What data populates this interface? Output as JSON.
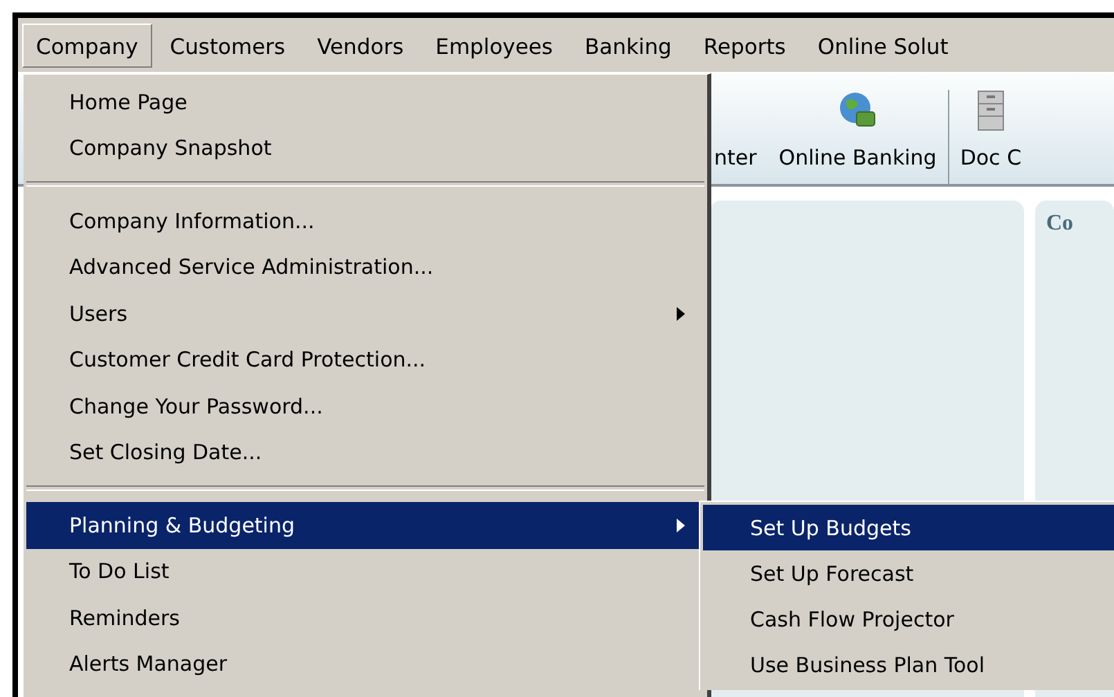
{
  "menu_bar": [
    {
      "label": "Company",
      "selected": true
    },
    {
      "label": "Customers",
      "selected": false
    },
    {
      "label": "Vendors",
      "selected": false
    },
    {
      "label": "Employees",
      "selected": false
    },
    {
      "label": "Banking",
      "selected": false
    },
    {
      "label": "Reports",
      "selected": false
    },
    {
      "label": "Online Solut",
      "selected": false
    }
  ],
  "toolbar": [
    {
      "label": "nter",
      "kind": "text"
    },
    {
      "label": "Online Banking",
      "kind": "globe"
    },
    {
      "label": "Doc C",
      "kind": "cabinet"
    }
  ],
  "panels": [
    {
      "kind": "blank"
    },
    {
      "kind": "titled",
      "title": "Co"
    }
  ],
  "dropdown": {
    "groups": [
      [
        {
          "label": "Home Page",
          "submenu": false,
          "selected": false
        },
        {
          "label": "Company Snapshot",
          "submenu": false,
          "selected": false
        }
      ],
      [
        {
          "label": "Company Information...",
          "submenu": false,
          "selected": false
        },
        {
          "label": "Advanced Service Administration...",
          "submenu": false,
          "selected": false
        },
        {
          "label": "Users",
          "submenu": true,
          "selected": false
        },
        {
          "label": "Customer Credit Card Protection...",
          "submenu": false,
          "selected": false
        },
        {
          "label": "Change Your Password...",
          "submenu": false,
          "selected": false
        },
        {
          "label": "Set Closing Date...",
          "submenu": false,
          "selected": false
        }
      ],
      [
        {
          "label": "Planning & Budgeting",
          "submenu": true,
          "selected": true
        },
        {
          "label": "To Do List",
          "submenu": false,
          "selected": false
        },
        {
          "label": "Reminders",
          "submenu": false,
          "selected": false
        },
        {
          "label": "Alerts Manager",
          "submenu": false,
          "selected": false
        }
      ]
    ]
  },
  "submenu": {
    "items": [
      {
        "label": "Set Up Budgets",
        "selected": true
      },
      {
        "label": "Set Up Forecast",
        "selected": false
      },
      {
        "label": "Cash Flow Projector",
        "selected": false
      },
      {
        "label": "Use Business Plan Tool",
        "selected": false
      }
    ]
  }
}
